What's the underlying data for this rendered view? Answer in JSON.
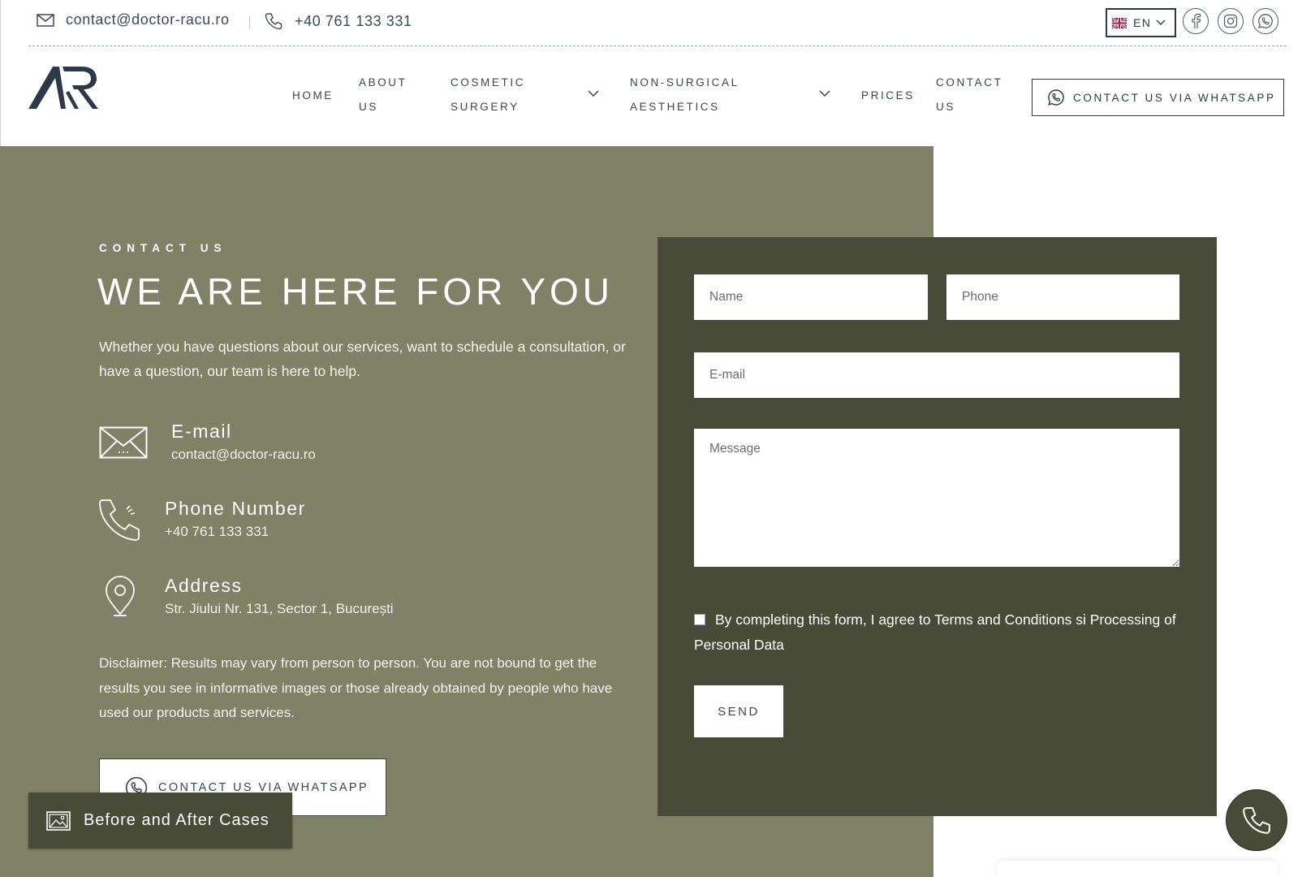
{
  "topbar": {
    "email": "contact@doctor-racu.ro",
    "phone": "+40 761 133 331",
    "language": "EN"
  },
  "nav": {
    "home": "HOME",
    "about": [
      "ABOUT",
      "US"
    ],
    "cosmetic": [
      "COSMETIC",
      "SURGERY"
    ],
    "nonsurgical": [
      "NON-SURGICAL",
      "AESTHETICS"
    ],
    "prices": "PRICES",
    "contact": [
      "CONTACT",
      "US"
    ],
    "whatsapp_button": "CONTACT US VIA WHATSAPP"
  },
  "hero": {
    "eyebrow": "CONTACT US",
    "headline": "WE ARE HERE FOR YOU",
    "intro": "Whether you have questions about our services, want to schedule a consultation, or have a question, our team is here to help."
  },
  "info": {
    "email_title": "E-mail",
    "email_value": "contact@doctor-racu.ro",
    "phone_title": "Phone Number",
    "phone_value": "+40 761 133 331",
    "address_title": "Address",
    "address_value": "Str. Jiului Nr. 131, Sector 1, București"
  },
  "disclaimer": "Disclaimer: Results may vary from person to person. You are not bound to get the results you see in informative images or those already obtained by people who have used our products and services.",
  "whatsapp_main": "CONTACT US VIA WHATSAPP",
  "before_after": "Before and After Cases",
  "form": {
    "name_placeholder": "Name",
    "phone_placeholder": "Phone",
    "email_placeholder": "E-mail",
    "message_placeholder": "Message",
    "consent": "By completing this form, I agree to Terms and Conditions si Processing of Personal Data",
    "send": "SEND"
  },
  "colors": {
    "olive": "#7f8266",
    "dark_olive": "#484b37",
    "navy": "#2c3a47"
  }
}
